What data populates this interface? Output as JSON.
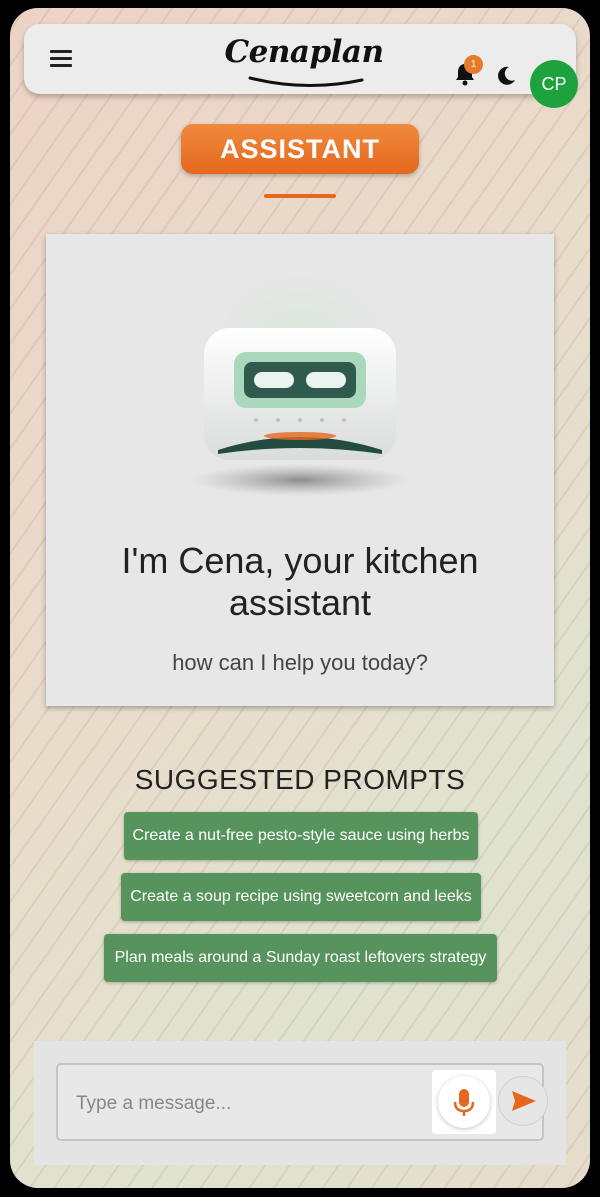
{
  "header": {
    "logo_text": "Cenaplan",
    "notification_count": "1",
    "avatar_initials": "CP",
    "icons": [
      "menu-icon",
      "bell-icon",
      "moon-icon"
    ]
  },
  "page": {
    "title": "ASSISTANT"
  },
  "assistant_card": {
    "heading": "I'm Cena, your kitchen assistant",
    "subheading": "how can I help you today?"
  },
  "prompts": {
    "heading": "SUGGESTED PROMPTS",
    "items": [
      "Create a nut-free pesto-style sauce using herbs",
      "Create a soup recipe using sweetcorn and leeks",
      "Plan meals around a Sunday roast leftovers strategy"
    ]
  },
  "composer": {
    "placeholder": "Type a message...",
    "icons": [
      "microphone-icon",
      "send-icon"
    ]
  },
  "colors": {
    "accent_orange": "#e5681d",
    "prompt_green": "#57935d",
    "avatar_green": "#1ea23d"
  }
}
